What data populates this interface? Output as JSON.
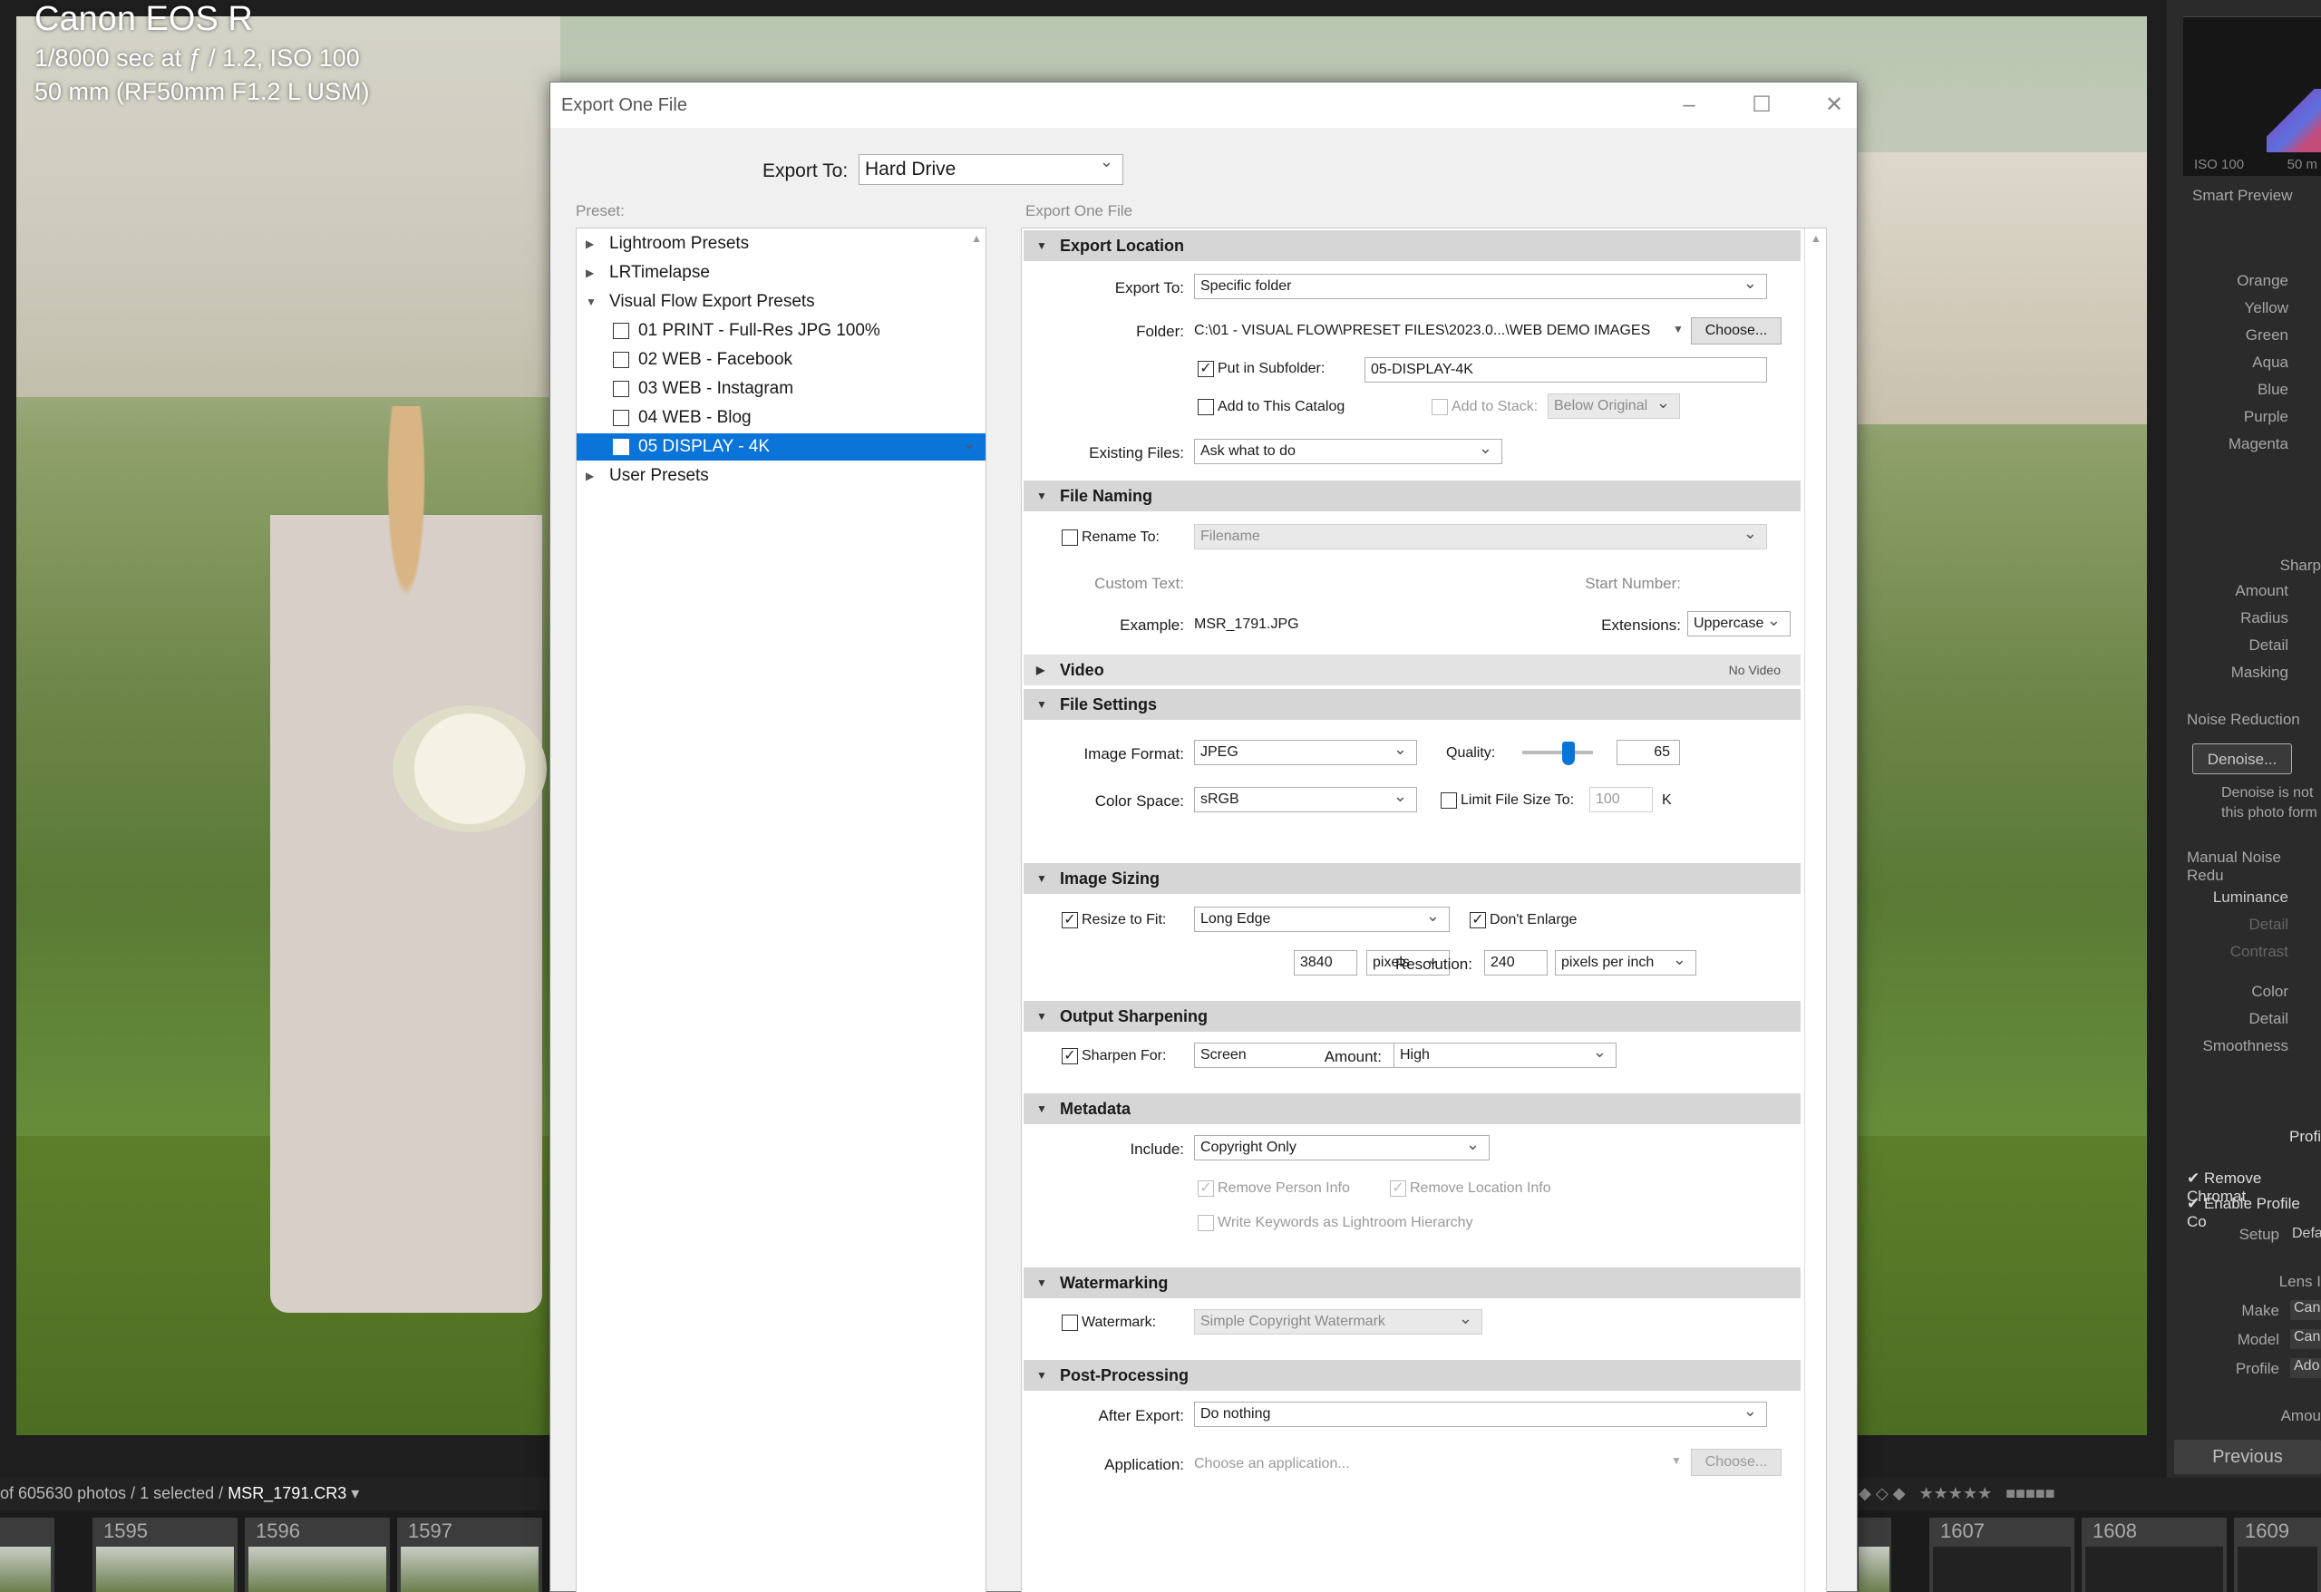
{
  "photo_info": {
    "camera": "Canon EOS R",
    "exposure": "1/8000 sec at ƒ / 1.2, ISO 100",
    "lens": "50 mm (RF50mm F1.2 L USM)"
  },
  "right_panel": {
    "hist_iso": "ISO 100",
    "hist_mm": "50 m",
    "smart_preview": "Smart Preview",
    "hsl_items": [
      "Orange",
      "Yellow",
      "Green",
      "Aqua",
      "Blue",
      "Purple",
      "Magenta"
    ],
    "sharpening_title": "Sharp",
    "sharpening_items": [
      "Amount",
      "Radius",
      "Detail",
      "Masking"
    ],
    "noise_reduction": "Noise Reduction",
    "denoise_button": "Denoise...",
    "denoise_note_1": "Denoise is not",
    "denoise_note_2": "this photo form",
    "manual_noise": "Manual Noise Redu",
    "luminance_items": [
      "Luminance",
      "Detail",
      "Contrast"
    ],
    "color_items": [
      "Color",
      "Detail",
      "Smoothness"
    ],
    "profile_tab": "Profi",
    "remove_chromatic": "Remove Chromat",
    "enable_profile": "Enable Profile Co",
    "setup_label": "Setup",
    "setup_value": "Defa",
    "lens_label": "Lens I",
    "make_label": "Make",
    "make_value": "Can",
    "model_label": "Model",
    "model_value": "Can",
    "profile_label": "Profile",
    "profile_value": "Ado",
    "amount_label": "Amou",
    "previous_button": "Previous"
  },
  "filmstrip": {
    "count_text": "of 605630 photos / 1 selected / ",
    "current_file": "MSR_1791.CR3",
    "left_frames": [
      "1595",
      "1596",
      "1597"
    ],
    "right_frames": [
      "1607",
      "1608",
      "1609"
    ]
  },
  "dialog": {
    "title": "Export One File",
    "export_to_label": "Export To:",
    "export_to_value": "Hard Drive",
    "preset_label": "Preset:",
    "settings_label": "Export One File",
    "presets": {
      "lightroom": "Lightroom Presets",
      "lrtimelapse": "LRTimelapse",
      "visual_flow": "Visual Flow Export Presets",
      "vf_items": [
        "01 PRINT - Full-Res JPG 100%",
        "02 WEB - Facebook",
        "03 WEB - Instagram",
        "04 WEB - Blog",
        "05 DISPLAY - 4K"
      ],
      "user": "User Presets"
    },
    "export_location": {
      "header": "Export Location",
      "export_to_label": "Export To:",
      "export_to_value": "Specific folder",
      "folder_label": "Folder:",
      "folder_value": "C:\\01 - VISUAL FLOW\\PRESET FILES\\2023.0...\\WEB DEMO IMAGES",
      "choose_button": "Choose...",
      "subfolder_label": "Put in Subfolder:",
      "subfolder_value": "05-DISPLAY-4K",
      "add_catalog_label": "Add to This Catalog",
      "add_stack_label": "Add to Stack:",
      "stack_value": "Below Original",
      "existing_label": "Existing Files:",
      "existing_value": "Ask what to do"
    },
    "file_naming": {
      "header": "File Naming",
      "rename_label": "Rename To:",
      "rename_value": "Filename",
      "custom_text_label": "Custom Text:",
      "start_number_label": "Start Number:",
      "example_label": "Example:",
      "example_value": "MSR_1791.JPG",
      "extensions_label": "Extensions:",
      "extensions_value": "Uppercase"
    },
    "video": {
      "header": "Video",
      "note": "No Video"
    },
    "file_settings": {
      "header": "File Settings",
      "format_label": "Image Format:",
      "format_value": "JPEG",
      "quality_label": "Quality:",
      "quality_value": "65",
      "quality_level": 65,
      "colorspace_label": "Color Space:",
      "colorspace_value": "sRGB",
      "limit_label": "Limit File Size To:",
      "limit_value": "100",
      "limit_unit": "K"
    },
    "image_sizing": {
      "header": "Image Sizing",
      "resize_label": "Resize to Fit:",
      "resize_value": "Long Edge",
      "dont_enlarge": "Don't Enlarge",
      "size_value": "3840",
      "size_unit": "pixels",
      "resolution_label": "Resolution:",
      "resolution_value": "240",
      "resolution_unit": "pixels per inch"
    },
    "output_sharpening": {
      "header": "Output Sharpening",
      "sharpen_label": "Sharpen For:",
      "sharpen_value": "Screen",
      "amount_label": "Amount:",
      "amount_value": "High"
    },
    "metadata": {
      "header": "Metadata",
      "include_label": "Include:",
      "include_value": "Copyright Only",
      "remove_person": "Remove Person Info",
      "remove_location": "Remove Location Info",
      "write_keywords": "Write Keywords as Lightroom Hierarchy"
    },
    "watermarking": {
      "header": "Watermarking",
      "watermark_label": "Watermark:",
      "watermark_value": "Simple Copyright Watermark"
    },
    "post_processing": {
      "header": "Post-Processing",
      "after_label": "After Export:",
      "after_value": "Do nothing",
      "app_label": "Application:",
      "app_placeholder": "Choose an application...",
      "choose_button": "Choose..."
    }
  }
}
